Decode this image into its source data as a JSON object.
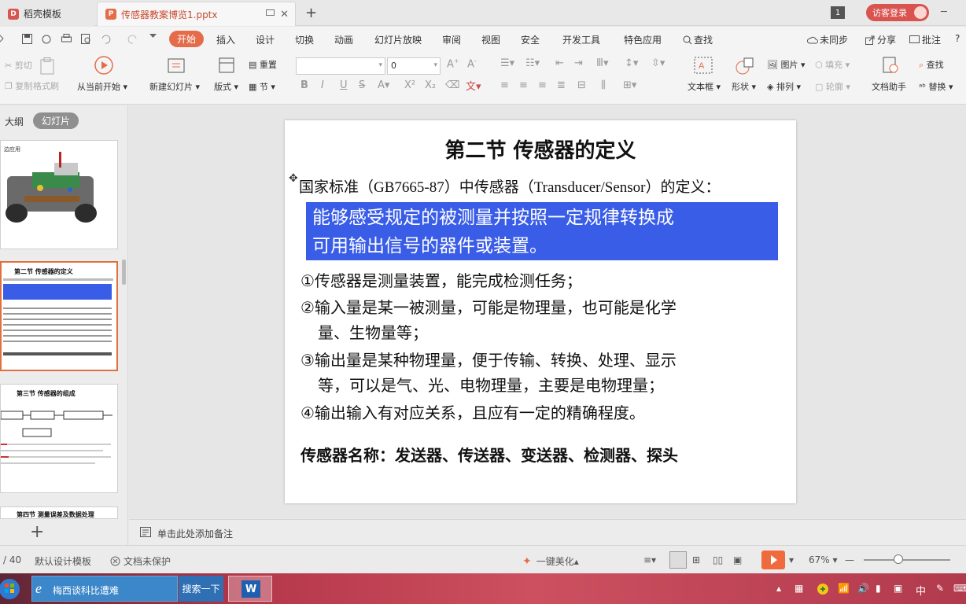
{
  "tabs": [
    {
      "label": "稻壳模板",
      "color": "#d9534f"
    },
    {
      "label": "传感器教案博览1.pptx",
      "color": "#e46c4a"
    }
  ],
  "titlebar": {
    "page_indicator": "1",
    "login": "访客登录"
  },
  "menu": {
    "start": "开始",
    "items": [
      "插入",
      "设计",
      "切换",
      "动画",
      "幻灯片放映",
      "审阅",
      "视图",
      "安全",
      "开发工具",
      "特色应用"
    ],
    "search": "查找",
    "sync": "未同步",
    "share": "分享",
    "comment": "批注"
  },
  "toolbar": {
    "cut": "剪切",
    "copy": "复制",
    "format_painter": "格式刷",
    "from_current": "从当前开始",
    "new_slide": "新建幻灯片",
    "layout": "版式",
    "reset": "重置",
    "section": "节",
    "font_size": "0",
    "textbox": "文本框",
    "shape": "形状",
    "picture": "图片",
    "fill": "填充",
    "arrange": "排列",
    "outline": "轮廓",
    "doc_helper": "文档助手",
    "find": "查找",
    "replace": "替换"
  },
  "left_panel": {
    "outline_tab": "大纲",
    "slides_tab": "幻灯片",
    "thumb1_caption": "边应用",
    "thumb2_title": "第二节 传感器的定义",
    "thumb3_title": "第三节 传感器的组成",
    "thumb4_title": "第四节 测量误差及数据处理"
  },
  "slide": {
    "title": "第二节  传感器的定义",
    "standard": "国家标准（GB7665-87）中传感器（Transducer/Sensor）的定义：",
    "highlight_line1": "能够感受规定的被测量并按照一定规律转换成",
    "highlight_line2": "可用输出信号的器件或装置。",
    "point1": "①传感器是测量装置，能完成检测任务；",
    "point2a": "②输入量是某一被测量，可能是物理量，也可能是化学",
    "point2b": "量、生物量等；",
    "point3a": "③输出量是某种物理量，便于传输、转换、处理、显示",
    "point3b": "等，可以是气、光、电物理量，主要是电物理量；",
    "point4": "④输出输入有对应关系，且应有一定的精确程度。",
    "names": "传感器名称：发送器、传送器、变送器、检测器、探头"
  },
  "notes": {
    "placeholder": "单击此处添加备注"
  },
  "status": {
    "slide_count": "/ 40",
    "template": "默认设计模板",
    "protection": "文档未保护",
    "beautify": "一键美化",
    "zoom": "67%"
  },
  "taskbar": {
    "ie_label": "梅西谈科比遭难",
    "search_button": "搜索一下",
    "ime": "中"
  }
}
